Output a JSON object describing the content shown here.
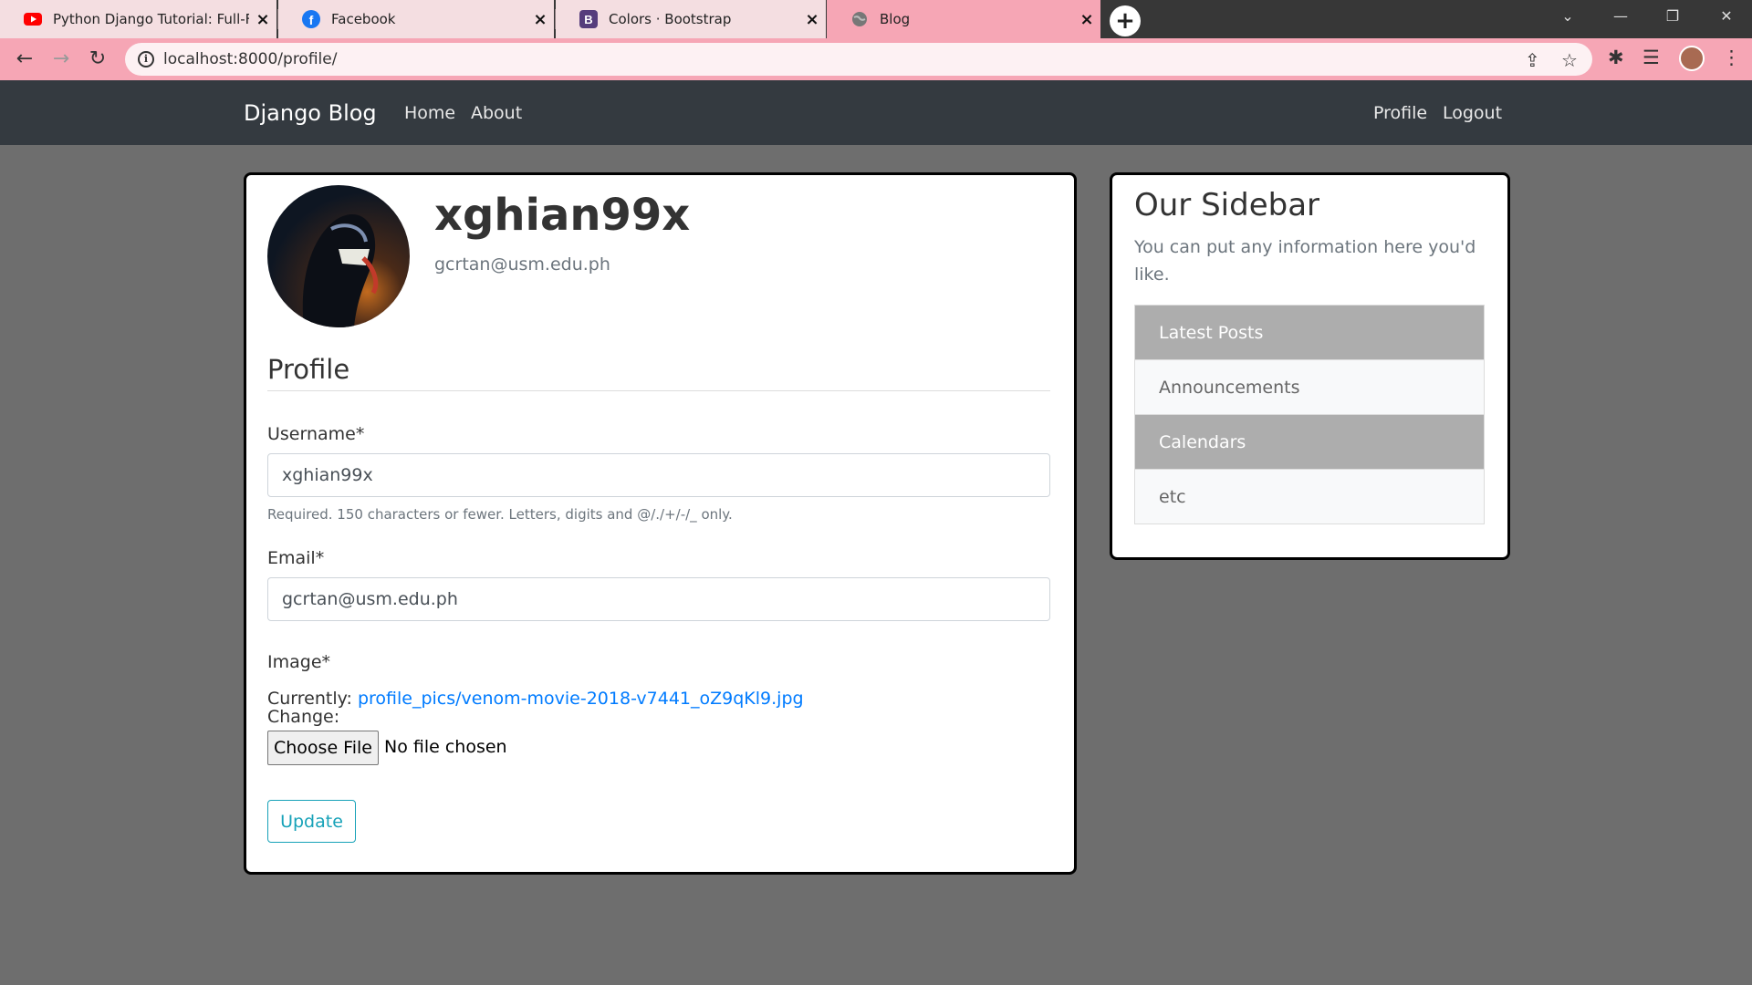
{
  "browser": {
    "tabs": [
      {
        "title": "Python Django Tutorial: Full-Featured",
        "icon": "youtube-icon"
      },
      {
        "title": "Facebook",
        "icon": "facebook-icon"
      },
      {
        "title": "Colors · Bootstrap",
        "icon": "bootstrap-icon"
      },
      {
        "title": "Blog",
        "icon": "globe-icon"
      }
    ],
    "url": "localhost:8000/profile/"
  },
  "navbar": {
    "brand": "Django Blog",
    "links_left": [
      "Home",
      "About"
    ],
    "links_right": [
      "Profile",
      "Logout"
    ]
  },
  "profile": {
    "username": "xghian99x",
    "email": "gcrtan@usm.edu.ph"
  },
  "form": {
    "legend": "Profile",
    "username_label": "Username*",
    "username_value": "xghian99x",
    "username_help": "Required. 150 characters or fewer. Letters, digits and @/./+/-/_ only.",
    "email_label": "Email*",
    "email_value": "gcrtan@usm.edu.ph",
    "image_label": "Image*",
    "currently_label": "Currently:",
    "current_file": "profile_pics/venom-movie-2018-v7441_oZ9qKl9.jpg",
    "change_label": "Change:",
    "choose_file": "Choose File",
    "no_file": "No file chosen",
    "submit": "Update"
  },
  "sidebar": {
    "title": "Our Sidebar",
    "text": "You can put any information here you'd like.",
    "items": [
      "Latest Posts",
      "Announcements",
      "Calendars",
      "etc"
    ]
  },
  "colors": {
    "navbar_bg": "#343a40",
    "page_bg": "#6e6e6e",
    "tab_active": "#f6a6b5",
    "link": "#007bff",
    "update_button": "#17a2b8"
  }
}
